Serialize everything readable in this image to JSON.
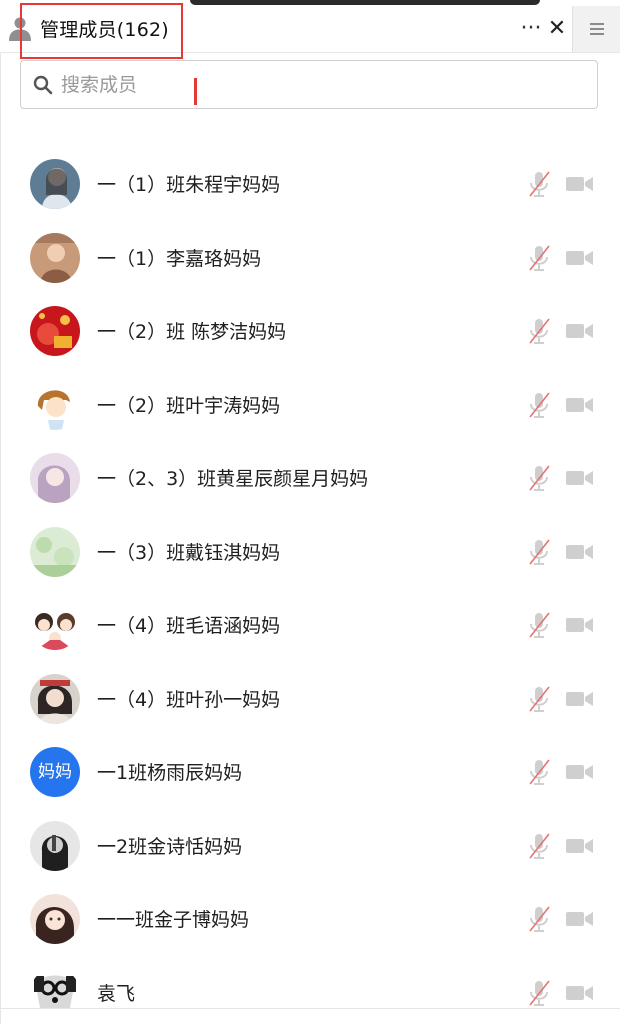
{
  "header": {
    "title": "管理成员(162)",
    "more_label": "···",
    "close_label": "✕"
  },
  "search": {
    "placeholder": "搜索成员",
    "value": ""
  },
  "accent": {
    "highlight": "#e53935",
    "avatar_blue": "#2576ee",
    "muted_red": "#e57373"
  },
  "members": [
    {
      "name": "一（1）班朱程宇妈妈",
      "avatar": "photo-girl"
    },
    {
      "name": "一（1）李嘉珞妈妈",
      "avatar": "photo-woman"
    },
    {
      "name": "一（2）班 陈梦洁妈妈",
      "avatar": "photo-red-festive"
    },
    {
      "name": "一（2）班叶宇涛妈妈",
      "avatar": "cartoon-boy"
    },
    {
      "name": "一（2、3）班黄星辰颜星月妈妈",
      "avatar": "photo-woman-pink"
    },
    {
      "name": "一（3）班戴钰淇妈妈",
      "avatar": "photo-green"
    },
    {
      "name": "一（4）班毛语涵妈妈",
      "avatar": "cartoon-family"
    },
    {
      "name": "一（4）班叶孙一妈妈",
      "avatar": "photo-woman-2"
    },
    {
      "name": "一1班杨雨辰妈妈",
      "avatar": "text",
      "avatar_text": "妈妈"
    },
    {
      "name": "一2班金诗恬妈妈",
      "avatar": "photo-bw"
    },
    {
      "name": "一一班金子博妈妈",
      "avatar": "photo-girl-2"
    },
    {
      "name": "袁飞",
      "avatar": "photo-dog"
    }
  ]
}
